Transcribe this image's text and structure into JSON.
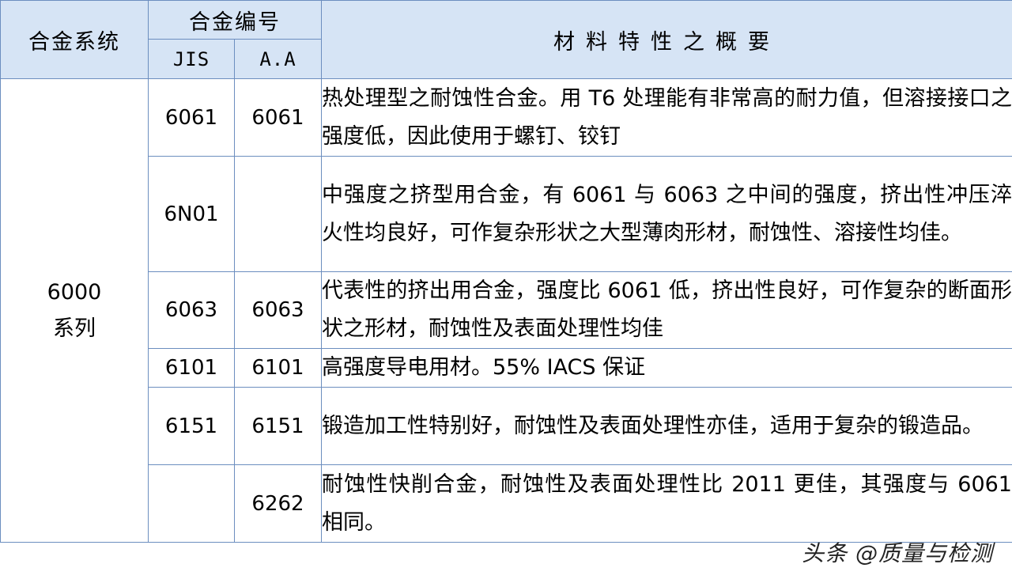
{
  "header": {
    "system": "合金系统",
    "alloy_no": "合金编号",
    "jis": "JIS",
    "aa": "A.A",
    "description": "材料特性之概要"
  },
  "series_label": [
    "6000",
    "系列"
  ],
  "rows": [
    {
      "jis": "6061",
      "aa": "6061",
      "text": "热处理型之耐蚀性合金。用 T6 处理能有非常高的耐力值，但溶接接口之强度低，因此使用于螺钉、铰钉"
    },
    {
      "jis": "6N01",
      "aa": "",
      "text": "中强度之挤型用合金，有 6061 与 6063 之中间的强度，挤出性冲压淬火性均良好，可作复杂形状之大型薄肉形材，耐蚀性、溶接性均佳。"
    },
    {
      "jis": "6063",
      "aa": "6063",
      "text": "代表性的挤出用合金，强度比 6061 低，挤出性良好，可作复杂的断面形状之形材，耐蚀性及表面处理性均佳"
    },
    {
      "jis": "6101",
      "aa": "6101",
      "text": "高强度导电用材。55% IACS 保证"
    },
    {
      "jis": "6151",
      "aa": "6151",
      "text": "锻造加工性特别好，耐蚀性及表面处理性亦佳，适用于复杂的锻造品。"
    },
    {
      "jis": "",
      "aa": "6262",
      "text": "耐蚀性快削合金，耐蚀性及表面处理性比 2011 更佳，其强度与 6061 相同。"
    }
  ],
  "watermark": "头条 @质量与检测"
}
